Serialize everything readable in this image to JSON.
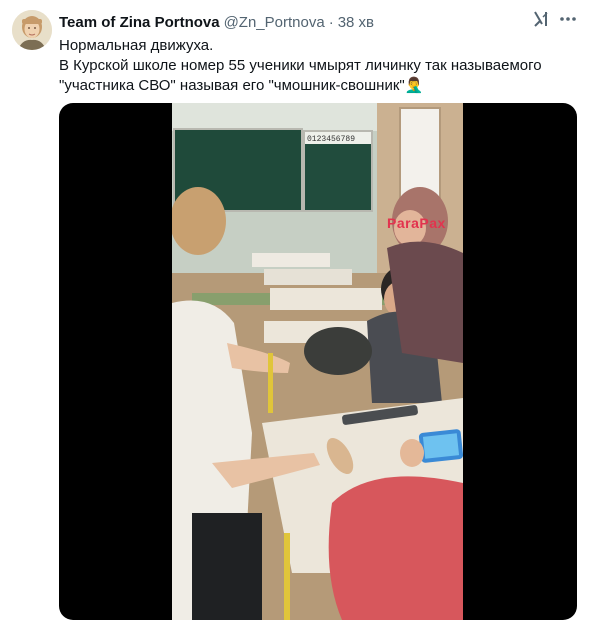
{
  "tweet": {
    "display_name": "Team of Zina Portnova",
    "handle": "@Zn_Portnova",
    "separator": "·",
    "timestamp": "38 хв",
    "text_lines": [
      "Нормальная движуха.",
      "В Курской школе номер 55 ученики чмырят личинку так называемого",
      "\"участника СВО\" называя его \"чмошник-свошник\"🤦‍♂️"
    ]
  },
  "icons": {
    "avatar": "avatar-portrait",
    "grok": "grok-icon",
    "more": "more-options-icon"
  },
  "media": {
    "type": "video",
    "watermark": "ParaPax",
    "board_numbers": "0123456789",
    "colors": {
      "letterbox": "#000000",
      "chalkboard": "#1f4a3a",
      "wall": "#c8d3c9",
      "desk": "#ece6da",
      "watermark": "#e2334e"
    }
  }
}
